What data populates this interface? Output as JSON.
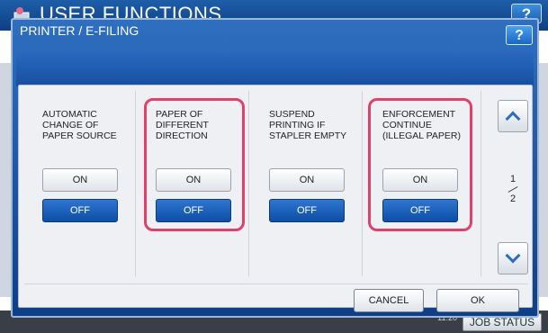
{
  "background": {
    "title": "USER FUNCTIONS",
    "help_label": "?",
    "time": "11:20",
    "job_status_label": "JOB STATUS"
  },
  "dialog": {
    "title": "PRINTER / E-FILING",
    "help_label": "?"
  },
  "settings": [
    {
      "label": "AUTOMATIC\nCHANGE OF\nPAPER SOURCE",
      "on_label": "ON",
      "off_label": "OFF",
      "selected": "OFF",
      "highlighted": false
    },
    {
      "label": "PAPER OF\nDIFFERENT\nDIRECTION",
      "on_label": "ON",
      "off_label": "OFF",
      "selected": "OFF",
      "highlighted": true
    },
    {
      "label": "SUSPEND\nPRINTING IF\nSTAPLER EMPTY",
      "on_label": "ON",
      "off_label": "OFF",
      "selected": "OFF",
      "highlighted": false
    },
    {
      "label": "ENFORCEMENT\nCONTINUE\n(ILLEGAL PAPER)",
      "on_label": "ON",
      "off_label": "OFF",
      "selected": "OFF",
      "highlighted": true
    }
  ],
  "pagination": {
    "current": "1",
    "total": "2"
  },
  "actions": {
    "cancel_label": "CANCEL",
    "ok_label": "OK"
  },
  "colors": {
    "accent_blue": "#0d4ea6",
    "highlight": "#e0416a",
    "header_blue": "#1e5ea8"
  }
}
